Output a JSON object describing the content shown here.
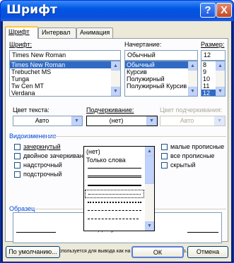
{
  "title": "Шрифт",
  "titlebar_buttons": {
    "help": "?",
    "close": "X"
  },
  "tabs": [
    {
      "label": "Шрифт"
    },
    {
      "label": "Интервал"
    },
    {
      "label": "Анимация"
    }
  ],
  "font": {
    "label": "Шрифт:",
    "value": "Times New Roman",
    "items": [
      "Times New Roman",
      "Trebuchet MS",
      "Tunga",
      "Tw Cen MT",
      "Verdana"
    ]
  },
  "style": {
    "label": "Начертание:",
    "value": "Обычный",
    "items": [
      "Обычный",
      "Курсив",
      "Полужирный",
      "Полужирный Курсив"
    ]
  },
  "size": {
    "label": "Размер:",
    "value": "12",
    "items": [
      "8",
      "9",
      "10",
      "11",
      "12"
    ]
  },
  "text_color": {
    "label": "Цвет текста:",
    "value": "Авто"
  },
  "underline": {
    "label": "Подчеркивание:",
    "value": "(нет)",
    "options": [
      "(нет)",
      "Только слова"
    ]
  },
  "underline_color": {
    "label": "Цвет подчеркивания:",
    "value": "Авто"
  },
  "effects": {
    "label": "Видоизменение",
    "left": [
      "зачеркнутый",
      "двойное зачеркивание",
      "надстрочный",
      "подстрочный"
    ],
    "right": [
      "малые прописные",
      "все прописные",
      "скрытый"
    ]
  },
  "preview": {
    "label": "Образец",
    "text": "документе"
  },
  "info": "Шрифт TrueType. Он используется для вывода как на экран, так и на принтер.",
  "buttons": {
    "default": "По умолчанию...",
    "ok": "ОК",
    "cancel": "Отмена"
  },
  "colors": {
    "selection": "#316ac5",
    "titlebar": "#0055e5",
    "dialog": "#ece9d8"
  }
}
